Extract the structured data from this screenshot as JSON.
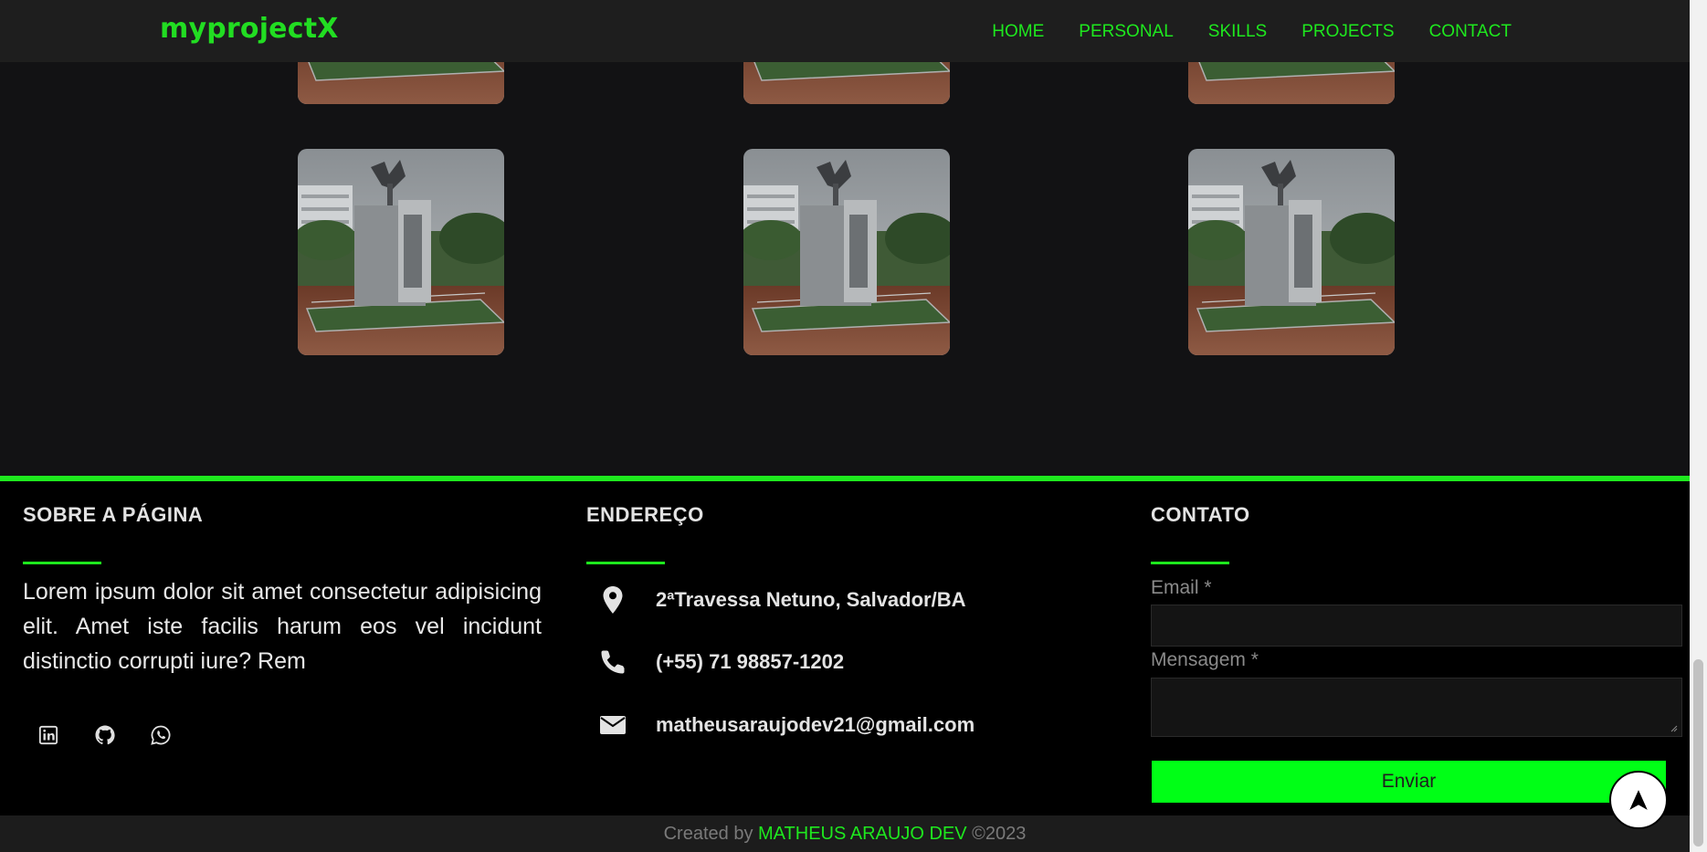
{
  "header": {
    "logo": "myprojectX",
    "nav": [
      "HOME",
      "PERSONAL",
      "SKILLS",
      "PROJECTS",
      "CONTACT"
    ]
  },
  "gallery": {
    "image_name": "monument-photo"
  },
  "footer": {
    "about": {
      "title": "SOBRE A PÁGINA",
      "text": "Lorem ipsum dolor sit amet consectetur adipisicing elit. Amet iste facilis harum eos vel incidunt distinctio corrupti iure? Rem",
      "social_icons": [
        "linkedin-icon",
        "github-icon",
        "whatsapp-icon"
      ]
    },
    "address": {
      "title": "ENDEREÇO",
      "location": "2ªTravessa Netuno, Salvador/BA",
      "phone": "(+55) 71 98857-1202",
      "email": "matheusaraujodev21@gmail.com"
    },
    "contact": {
      "title": "CONTATO",
      "email_label": "Email *",
      "message_label": "Mensagem *",
      "email_value": "",
      "message_value": "",
      "submit_label": "Enviar"
    }
  },
  "bottom": {
    "prefix": "Created by",
    "author": "MATHEUS ARAUJO DEV",
    "suffix": "©2023"
  },
  "colors": {
    "accent": "#1ee81e",
    "button": "#00ff16",
    "background": "#121214",
    "footer_bg": "#000000"
  }
}
